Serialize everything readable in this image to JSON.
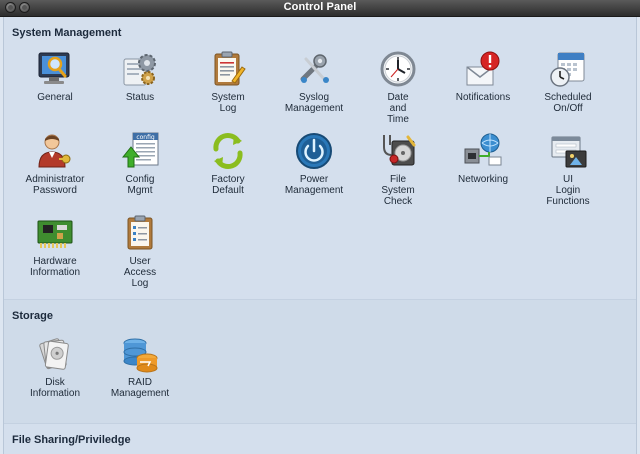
{
  "window": {
    "title": "Control Panel"
  },
  "sections": [
    {
      "title": "System Management",
      "items": [
        {
          "label": "General",
          "icon": "monitor-magnifier-icon"
        },
        {
          "label": "Status",
          "icon": "status-gears-icon"
        },
        {
          "label": "System\nLog",
          "icon": "clipboard-log-icon"
        },
        {
          "label": "Syslog\nManagement",
          "icon": "wrench-syslog-icon"
        },
        {
          "label": "Date\nand\nTime",
          "icon": "clock-icon"
        },
        {
          "label": "Notifications",
          "icon": "envelope-alert-icon"
        },
        {
          "label": "Scheduled\nOn/Off",
          "icon": "calendar-schedule-icon"
        },
        {
          "label": "Administrator\nPassword",
          "icon": "admin-user-key-icon"
        },
        {
          "label": "Config\nMgmt",
          "icon": "config-upload-icon"
        },
        {
          "label": "Factory\nDefault",
          "icon": "reset-arrows-icon"
        },
        {
          "label": "Power\nManagement",
          "icon": "power-button-icon"
        },
        {
          "label": "File\nSystem\nCheck",
          "icon": "stethoscope-disk-icon"
        },
        {
          "label": "Networking",
          "icon": "network-globe-icon"
        },
        {
          "label": "UI\nLogin\nFunctions",
          "icon": "ui-login-icon"
        },
        {
          "label": "Hardware\nInformation",
          "icon": "circuit-board-icon"
        },
        {
          "label": "User\nAccess\nLog",
          "icon": "user-access-log-icon"
        }
      ]
    },
    {
      "title": "Storage",
      "items": [
        {
          "label": "Disk\nInformation",
          "icon": "disk-stack-icon"
        },
        {
          "label": "RAID\nManagement",
          "icon": "raid-database-icon"
        }
      ]
    },
    {
      "title": "File Sharing/Priviledge",
      "items": []
    }
  ],
  "colors": {
    "titlebar": "#3a3a3a",
    "panel": "#d4dfed",
    "text": "#1e2a38"
  }
}
